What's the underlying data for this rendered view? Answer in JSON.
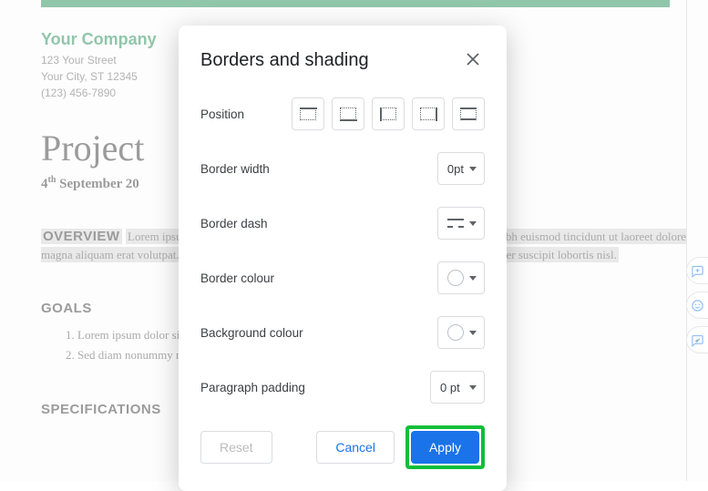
{
  "doc": {
    "company_name": "Your Company",
    "addr1": "123 Your Street",
    "addr2": "Your City, ST 12345",
    "phone": "(123) 456-7890",
    "title": "Project",
    "date_html": "4th September 20",
    "date_day": "4",
    "date_ord": "th",
    "date_rest": " September 20",
    "overview_h": "OVERVIEW",
    "overview_txt": "Lorem ipsum dolor sit amet, consectetuer adipiscing elit, sed diam nonummy nibh euismod tincidunt ut laoreet dolore magna aliquam erat volutpat. Ut wisi enim ad minim veniam, quis nostrud exerci tation ullamcorper suscipit lobortis nisl.",
    "goals_h": "GOALS",
    "goal1": "Lorem ipsum dolor sit amet.",
    "goal2": "Sed diam nonummy nibh euismod tincidunt ut laoreet dolore magna aliquam erat volutpat.",
    "specs_h": "SPECIFICATIONS"
  },
  "dialog": {
    "title": "Borders and shading",
    "labels": {
      "position": "Position",
      "border_width": "Border width",
      "border_dash": "Border dash",
      "border_colour": "Border colour",
      "background_colour": "Background colour",
      "paragraph_padding": "Paragraph padding"
    },
    "values": {
      "border_width": "0pt",
      "paragraph_padding": "0 pt"
    },
    "buttons": {
      "reset": "Reset",
      "cancel": "Cancel",
      "apply": "Apply"
    }
  }
}
